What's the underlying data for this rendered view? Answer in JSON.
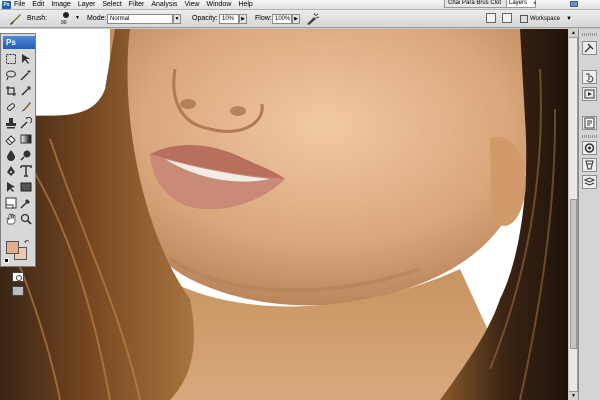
{
  "menubar": {
    "app_icon": "Ps",
    "items": [
      "File",
      "Edit",
      "Image",
      "Layer",
      "Select",
      "Filter",
      "Analysis",
      "View",
      "Window",
      "Help"
    ],
    "doc_tab_1": "Chai Para Brus Clot",
    "doc_tab_2": "Layers",
    "close_glyph": "×"
  },
  "options": {
    "brush_label": "Brush:",
    "brush_size": "90",
    "mode_label": "Mode:",
    "mode_value": "Normal",
    "opacity_label": "Opacity:",
    "opacity_value": "10%",
    "flow_label": "Flow:",
    "flow_value": "100%",
    "workspace_label": "Workspace"
  },
  "tools": {
    "logo": "Ps",
    "foreground_color": "#e3b08e",
    "background_color": "#ecc9b0"
  },
  "colors": {
    "accent": "#225fb4",
    "chrome": "#d8d8d8"
  }
}
